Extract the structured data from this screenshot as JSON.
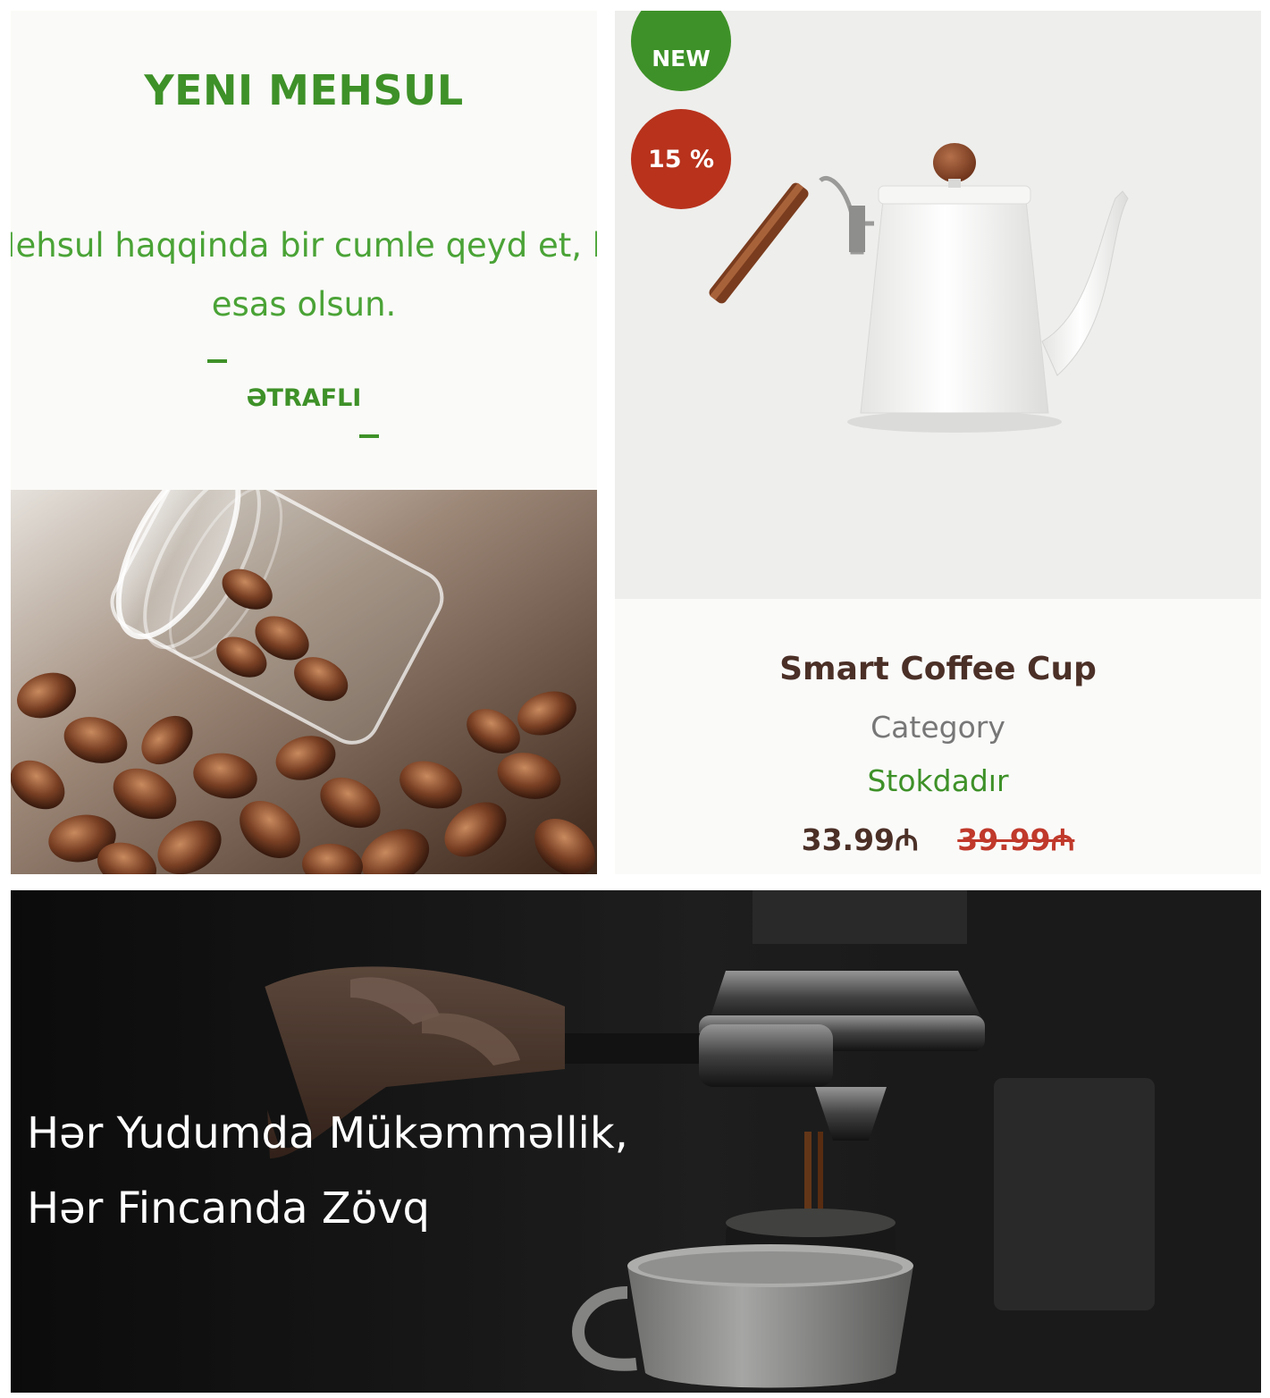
{
  "promo": {
    "title": "YENI MEHSUL",
    "text_line1": "Mehsul haqqinda bir cumle qeyd et, ki",
    "text_line2": "esas olsun.",
    "link_label": "ƏTRAFLI"
  },
  "product": {
    "badge_new": "NEW",
    "badge_discount": "15 %",
    "name": "Smart Coffee Cup",
    "category": "Category",
    "stock": "Stokdadır",
    "price_current": "33.99₼",
    "price_old": "39.99₼"
  },
  "hero": {
    "tagline_line1": "Hər Yudumda Mükəmməllik,",
    "tagline_line2": "Hər Fincanda Zövq"
  },
  "colors": {
    "brand_green": "#3e9128",
    "discount_red": "#b8321c",
    "brown_text": "#4b3027"
  }
}
